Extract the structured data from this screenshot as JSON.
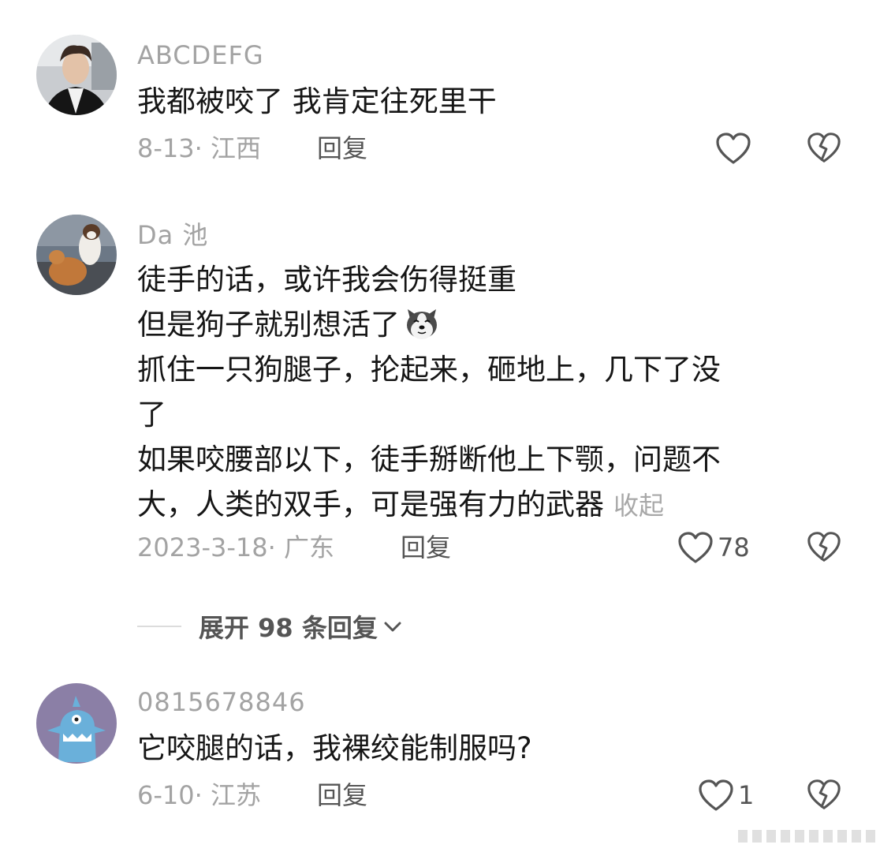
{
  "comments": [
    {
      "username": "ABCDEFG",
      "lines": [
        "我都被咬了 我肯定往死里干"
      ],
      "date_location": "8-13· 江西",
      "reply_label": "回复",
      "like_count": ""
    },
    {
      "username": "Da 池",
      "lines": [
        "徒手的话，或许我会伤得挺重",
        "但是狗子就别想活了",
        "抓住一只狗腿子，抡起来，砸地上，几下了没",
        "了",
        "如果咬腰部以下，徒手掰断他上下颚，问题不",
        "大，人类的双手，可是强有力的武器"
      ],
      "collapse_label": "收起",
      "date_location": "2023-3-18· 广东",
      "reply_label": "回复",
      "like_count": "78"
    },
    {
      "username": "0815678846",
      "lines": [
        "它咬腿的话，我裸绞能制服吗?"
      ],
      "date_location": "6-10· 江苏",
      "reply_label": "回复",
      "like_count": "1"
    }
  ],
  "expand_replies_label": "展开 98 条回复",
  "icons": {
    "like": "heart-outline-icon",
    "dislike": "broken-heart-icon",
    "expand": "chevron-down-icon",
    "inline_emoji": "husky-dog-emoji-icon"
  },
  "colors": {
    "text_primary": "#161616",
    "text_secondary": "#a3a3a3",
    "action_text": "#555555",
    "divider": "#dcdcdc"
  }
}
